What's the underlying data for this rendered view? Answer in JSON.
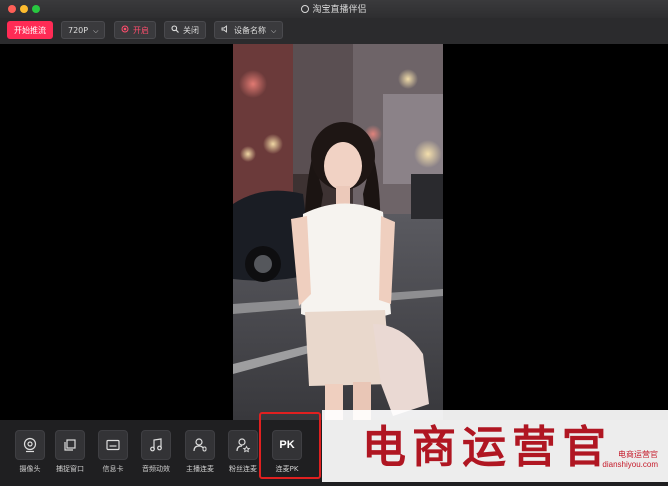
{
  "window": {
    "title": "淘宝直播伴侣"
  },
  "toolbar": {
    "start_stream": "开始推流",
    "resolution": "720P",
    "live_label": "开启",
    "close_label": "关闭",
    "device_label": "设备名称"
  },
  "bottom_tools": [
    {
      "label": "摄像头",
      "icon": "camera-icon"
    },
    {
      "label": "捕捉窗口",
      "icon": "window-capture-icon"
    },
    {
      "label": "信息卡",
      "icon": "info-card-icon"
    },
    {
      "label": "音频动效",
      "icon": "music-note-icon"
    },
    {
      "label": "主播连麦",
      "icon": "user-mic-icon"
    },
    {
      "label": "粉丝连麦",
      "icon": "fan-user-icon"
    },
    {
      "label": "连麦PK",
      "icon": "pk-icon",
      "icon_text": "PK"
    }
  ],
  "watermark": {
    "main": "电商运营官",
    "side_line1": "电商运营官",
    "side_line2": "dianshiyou.com"
  },
  "colors": {
    "accent": "#ff2b55",
    "highlight": "#e02020",
    "watermark": "#b01622"
  }
}
